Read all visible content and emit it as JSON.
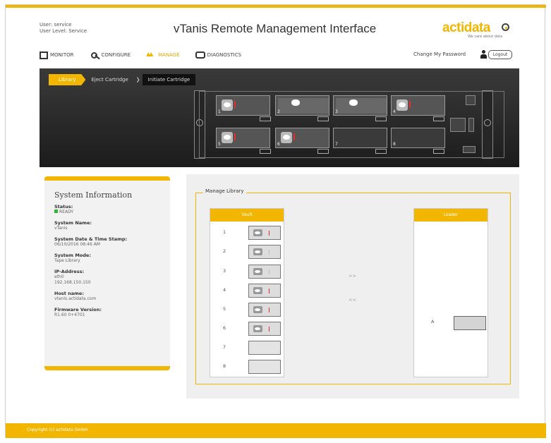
{
  "header": {
    "user_line1": "User: service",
    "user_line2": "User Level: Service",
    "title": "vTanis Remote Management Interface",
    "logo_text": "actidata",
    "tagline": "We care about data",
    "change_password": "Change My Password",
    "logout": "Logout"
  },
  "nav": {
    "monitor": "MONITOR",
    "configure": "CONFIGURE",
    "manage": "MANAGE",
    "diagnostics": "DIAGNOSTICS"
  },
  "breadcrumbs": {
    "home": "Library",
    "eject": "Eject Cartridge",
    "sep": "❯",
    "initiate": "Initiate Cartridge"
  },
  "chassis": {
    "slots": [
      "1",
      "2",
      "3",
      "4",
      "5",
      "6",
      "7",
      "8"
    ]
  },
  "system_info": {
    "title": "System Information",
    "status_label": "Status:",
    "status_value": "READY",
    "name_label": "System Name:",
    "name_value": "vTanis",
    "date_label": "System Date & Time Stamp:",
    "date_value": "06/10/2016 08:46 AM",
    "mode_label": "System Mode:",
    "mode_value": "Tape Library",
    "ip_label": "IP-Address:",
    "ip_iface": "eth0",
    "ip_value": "192.168.150.150",
    "host_label": "Host name:",
    "host_value": "vtanis.actidata.com",
    "fw_label": "Firmware Version:",
    "fw_value": "R1.60 0+4701"
  },
  "manage_library": {
    "legend": "Manage Library",
    "vault_header": "Vault",
    "load_header": "Loader",
    "move_right": ">>",
    "move_left": "<<",
    "vault_slots": [
      "1",
      "2",
      "3",
      "4",
      "5",
      "6",
      "7",
      "8"
    ],
    "loader_slot": "A"
  },
  "footer": {
    "copyright": "Copyright (c) actidata GmbH"
  },
  "colors": {
    "accent": "#f2b600",
    "dark": "#262626",
    "status_green": "#2fb52f"
  }
}
